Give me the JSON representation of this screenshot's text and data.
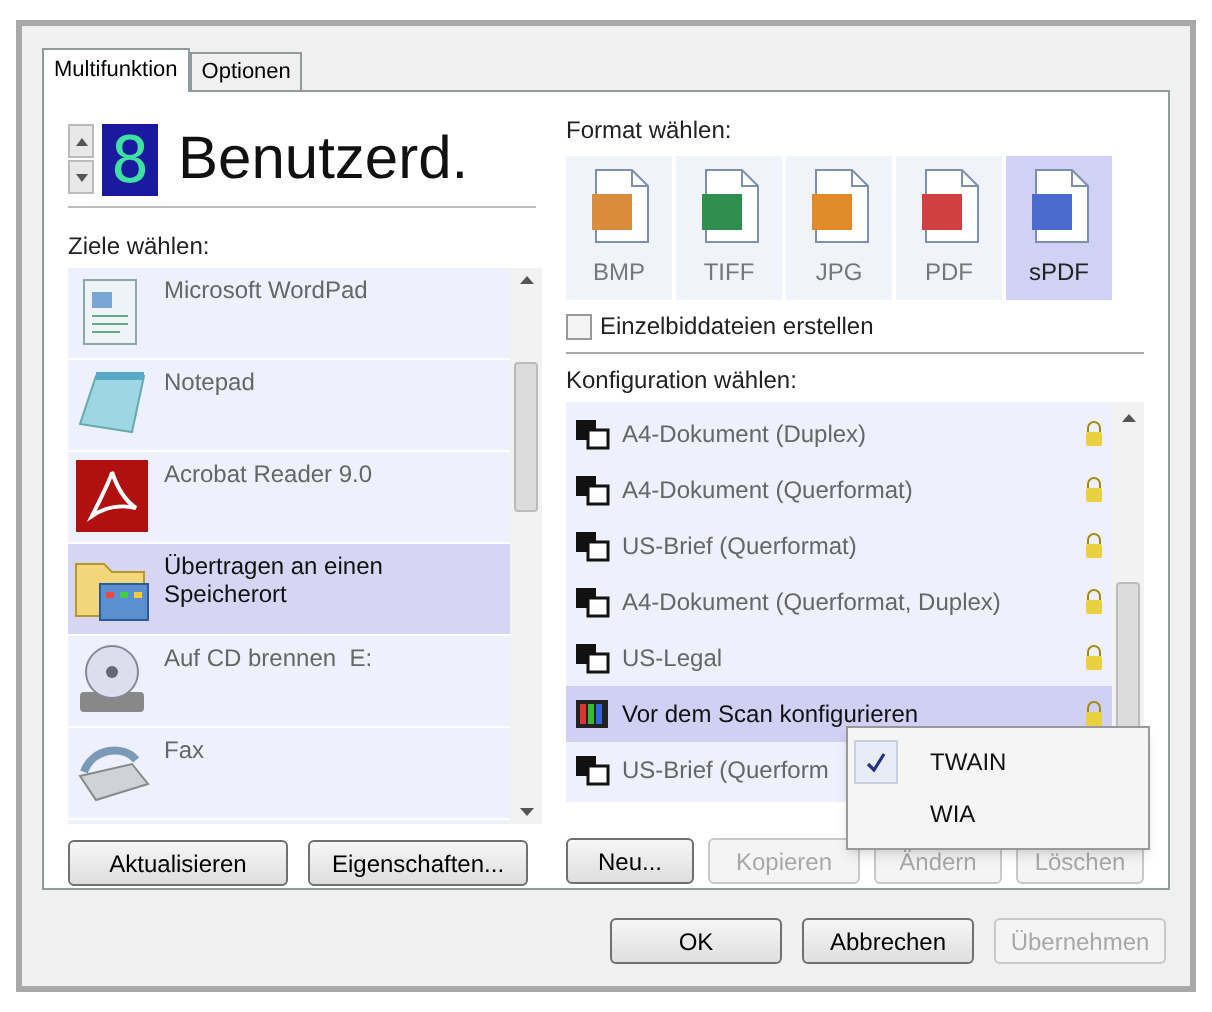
{
  "tabs": [
    {
      "label": "Multifunktion",
      "selected": true
    },
    {
      "label": "Optionen",
      "selected": false
    }
  ],
  "profile": {
    "digit": "8",
    "name": "Benutzerd."
  },
  "destinations": {
    "label": "Ziele wählen:",
    "items": [
      {
        "kind": "wordpad",
        "name": "Microsoft WordPad",
        "selected": false
      },
      {
        "kind": "notepad",
        "name": "Notepad",
        "selected": false
      },
      {
        "kind": "acrobat",
        "name": "Acrobat Reader 9.0",
        "selected": false
      },
      {
        "kind": "folder",
        "name": "Übertragen an einen Speicherort",
        "selected": true
      },
      {
        "kind": "cd",
        "name": "Auf CD brennen  E:",
        "selected": false
      },
      {
        "kind": "fax",
        "name": "Fax",
        "selected": false
      }
    ]
  },
  "left_buttons": [
    {
      "label": "Aktualisieren",
      "disabled": false
    },
    {
      "label": "Eigenschaften...",
      "disabled": false
    }
  ],
  "formats": {
    "label": "Format wählen:",
    "items": [
      {
        "kind": "bmp",
        "label": "BMP",
        "selected": false
      },
      {
        "kind": "tiff",
        "label": "TIFF",
        "selected": false
      },
      {
        "kind": "jpg",
        "label": "JPG",
        "selected": false
      },
      {
        "kind": "pdf",
        "label": "PDF",
        "selected": false
      },
      {
        "kind": "spdf",
        "label": "sPDF",
        "selected": true
      }
    ]
  },
  "single_files": {
    "label": "Einzelbiddateien erstellen",
    "checked": false
  },
  "configurations": {
    "label": "Konfiguration wählen:",
    "items": [
      {
        "kind": "scanner",
        "name": "A4-Dokument (Duplex)",
        "selected": false,
        "locked": true
      },
      {
        "kind": "scanner",
        "name": "A4-Dokument (Querformat)",
        "selected": false,
        "locked": true
      },
      {
        "kind": "scanner",
        "name": "US-Brief (Querformat)",
        "selected": false,
        "locked": true
      },
      {
        "kind": "scanner",
        "name": "A4-Dokument (Querformat, Duplex)",
        "selected": false,
        "locked": true
      },
      {
        "kind": "scanner",
        "name": "US-Legal",
        "selected": false,
        "locked": true
      },
      {
        "kind": "color",
        "name": "Vor dem Scan konfigurieren",
        "selected": true,
        "locked": true
      },
      {
        "kind": "scanner",
        "name": "US-Brief (Querform",
        "selected": false
      }
    ]
  },
  "context_menu": [
    {
      "label": "TWAIN",
      "checked": true
    },
    {
      "label": "WIA",
      "checked": false
    }
  ],
  "right_buttons": [
    {
      "label": "Neu...",
      "disabled": false
    },
    {
      "label": "Kopieren",
      "disabled": true
    },
    {
      "label": "Ändern",
      "disabled": true
    },
    {
      "label": "Löschen",
      "disabled": true
    }
  ],
  "footer_buttons": [
    {
      "label": "OK",
      "disabled": false
    },
    {
      "label": "Abbrechen",
      "disabled": false
    },
    {
      "label": "Übernehmen",
      "disabled": true
    }
  ]
}
